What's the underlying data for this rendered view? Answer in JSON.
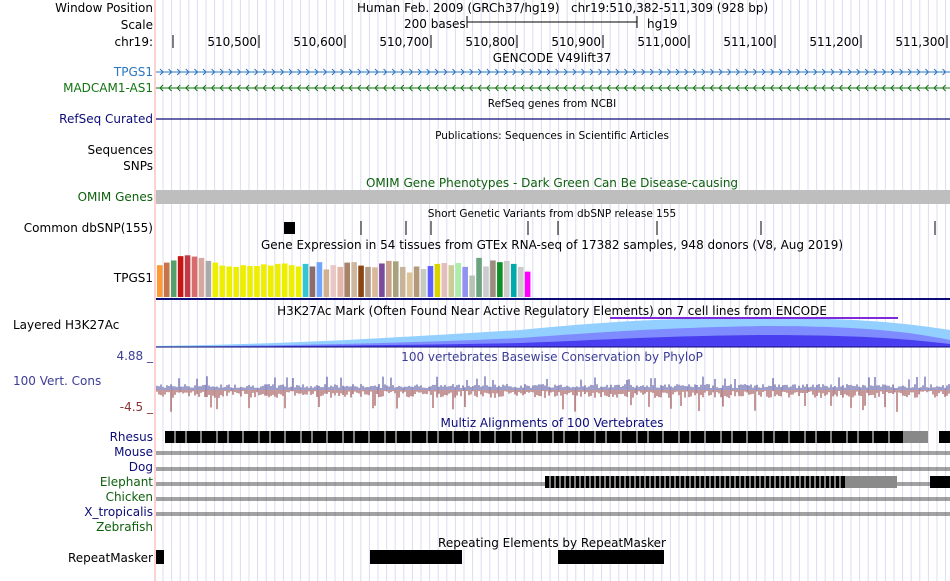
{
  "header": {
    "window_position_label": "Window Position",
    "assembly": "Human Feb. 2009 (GRCh37/hg19)",
    "position": "chr19:510,382-511,309 (928 bp)",
    "scale_label": "Scale",
    "scale_text": "200 bases",
    "db": "hg19",
    "chrom_label": "chr19:",
    "ruler_ticks": [
      "510,500",
      "510,600",
      "510,700",
      "510,800",
      "510,900",
      "511,000",
      "511,100",
      "511,200",
      "511,300"
    ]
  },
  "tracks": {
    "gencode": {
      "title": "GENCODE V49lift37",
      "genes": [
        "TPGS1",
        "MADCAM1-AS1"
      ],
      "colors": [
        "#2a74c0",
        "#117411"
      ]
    },
    "refseq": {
      "label": "RefSeq Curated",
      "title": "RefSeq genes from NCBI",
      "color": "#0c0c78"
    },
    "publications": {
      "title": "Publications: Sequences in Scientific Articles",
      "labels": [
        "Sequences",
        "SNPs"
      ]
    },
    "omim": {
      "label": "OMIM Genes",
      "title": "OMIM Gene Phenotypes - Dark Green Can Be Disease-causing",
      "color": "#0d5f0d",
      "bar_color": "#bebebe"
    },
    "dbsnp": {
      "label": "Common dbSNP(155)",
      "title": "Short Genetic Variants from dbSNP release 155"
    },
    "gtex": {
      "label": "TPGS1",
      "title": "Gene Expression in 54 tissues from GTEx RNA-seq of 17382 samples, 948 donors (V8, Aug 2019)",
      "bar_heights": [
        0.74,
        0.8,
        0.85,
        0.95,
        0.97,
        0.94,
        0.91,
        0.84,
        0.8,
        0.73,
        0.71,
        0.7,
        0.74,
        0.72,
        0.72,
        0.76,
        0.73,
        0.77,
        0.78,
        0.74,
        0.71,
        0.77,
        0.71,
        0.81,
        0.64,
        0.74,
        0.7,
        0.8,
        0.81,
        0.73,
        0.7,
        0.69,
        0.78,
        0.84,
        0.83,
        0.7,
        0.57,
        0.71,
        0.65,
        0.72,
        0.77,
        0.79,
        0.74,
        0.79,
        0.7,
        0.5,
        0.91,
        0.71,
        0.85,
        0.81,
        0.84,
        0.77,
        0.7,
        0.59
      ],
      "bar_colors": [
        "#ff9933",
        "#c8744a",
        "#55a06a",
        "#c71414",
        "#c13b46",
        "#d86c6c",
        "#d7a89d",
        "#aaaaaa",
        "#eeee00",
        "#eeee00",
        "#eeee00",
        "#eeee00",
        "#eeee00",
        "#eeee00",
        "#eeee00",
        "#eeee00",
        "#eeee00",
        "#eeee00",
        "#eeee00",
        "#eeee00",
        "#eeee00",
        "#34c5d3",
        "#8a6e6e",
        "#6fa4ff",
        "#d0b08e",
        "#e8c7c7",
        "#e6b5a6",
        "#a88368",
        "#cdb79e",
        "#8b4513",
        "#b39b86",
        "#d9b999",
        "#7a4b9b",
        "#c8a28a",
        "#a8a27c",
        "#c6b59b",
        "#ddc39a",
        "#b49a7a",
        "#c7cac1",
        "#6060ff",
        "#d9d400",
        "#e4bdbd",
        "#cccc99",
        "#aaeeaa",
        "#9292f0",
        "#b7c4b4",
        "#6aa47f",
        "#cbcbcb",
        "#9b8d7e",
        "#0b8f26",
        "#cccccc",
        "#00aaaa",
        "#cccccc",
        "#ff00ff"
      ]
    },
    "h3k27ac": {
      "label": "Layered H3K27Ac",
      "title": "H3K27Ac Mark (Often Found Near Active Regulatory Elements) on 7 cell lines from ENCODE"
    },
    "phylop": {
      "label": "100 Vert. Cons",
      "max_label": "4.88 _",
      "min_label": "-4.5 _",
      "title": "100 vertebrates Basewise Conservation by PhyloP",
      "label_color": "#3c3c96",
      "pos_color": "#3c3c96",
      "neg_color": "#8c3232"
    },
    "multiz": {
      "title": "Multiz Alignments of 100 Vertebrates",
      "species": [
        "Rhesus",
        "Mouse",
        "Dog",
        "Elephant",
        "Chicken",
        "X_tropicalis",
        "Zebrafish"
      ],
      "species_colors": [
        "#0c0c78",
        "#0c0c78",
        "#0c0c78",
        "#0d5f0d",
        "#0d5f0d",
        "#0c0c78",
        "#0d5f0d"
      ]
    },
    "repeatmasker": {
      "label": "RepeatMasker",
      "title": "Repeating Elements by RepeatMasker"
    }
  }
}
